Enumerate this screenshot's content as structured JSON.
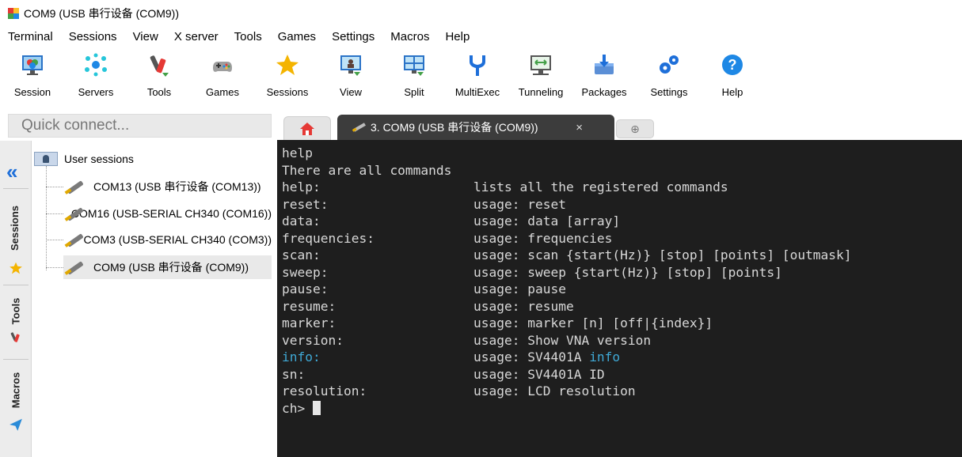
{
  "window": {
    "title": "COM9  (USB 串行设备 (COM9))"
  },
  "menubar": [
    "Terminal",
    "Sessions",
    "View",
    "X server",
    "Tools",
    "Games",
    "Settings",
    "Macros",
    "Help"
  ],
  "toolbar": [
    {
      "label": "Session",
      "icon": "monitor-session-icon"
    },
    {
      "label": "Servers",
      "icon": "servers-network-icon"
    },
    {
      "label": "Tools",
      "icon": "tools-icon"
    },
    {
      "label": "Games",
      "icon": "gamepad-icon"
    },
    {
      "label": "Sessions",
      "icon": "star-icon"
    },
    {
      "label": "View",
      "icon": "view-monitor-icon"
    },
    {
      "label": "Split",
      "icon": "split-window-icon"
    },
    {
      "label": "MultiExec",
      "icon": "multiexec-fork-icon"
    },
    {
      "label": "Tunneling",
      "icon": "tunneling-icon"
    },
    {
      "label": "Packages",
      "icon": "packages-download-icon"
    },
    {
      "label": "Settings",
      "icon": "gears-icon"
    },
    {
      "label": "Help",
      "icon": "help-question-icon"
    }
  ],
  "quick_connect": {
    "placeholder": "Quick connect..."
  },
  "tabs": {
    "active": {
      "label": "3. COM9  (USB 串行设备 (COM9))",
      "close": "×"
    },
    "new_tab": "⊕"
  },
  "side_rail": {
    "collapse": "«",
    "sessions": "Sessions",
    "tools": "Tools",
    "macros": "Macros"
  },
  "session_tree": {
    "root": "User sessions",
    "items": [
      {
        "label": "COM13  (USB 串行设备 (COM13))"
      },
      {
        "label": "COM16  (USB-SERIAL CH340 (COM16))"
      },
      {
        "label": "COM3  (USB-SERIAL CH340 (COM3))"
      },
      {
        "label": "COM9  (USB 串行设备 (COM9))"
      }
    ]
  },
  "terminal": {
    "lines": [
      {
        "cmd": "help",
        "desc": ""
      },
      {
        "cmd": "There are all commands",
        "desc": ""
      },
      {
        "cmd": "help:",
        "desc": "lists all the registered commands"
      },
      {
        "cmd": "reset:",
        "desc": "usage: reset"
      },
      {
        "cmd": "data:",
        "desc": "usage: data [array]"
      },
      {
        "cmd": "frequencies:",
        "desc": "usage: frequencies"
      },
      {
        "cmd": "scan:",
        "desc": "usage: scan {start(Hz)} [stop] [points] [outmask]"
      },
      {
        "cmd": "sweep:",
        "desc": "usage: sweep {start(Hz)} [stop] [points]"
      },
      {
        "cmd": "pause:",
        "desc": "usage: pause"
      },
      {
        "cmd": "resume:",
        "desc": "usage: resume"
      },
      {
        "cmd": "marker:",
        "desc": "usage: marker [n] [off|{index}]"
      },
      {
        "cmd": "version:",
        "desc": "usage: Show VNA version"
      },
      {
        "cmd": "info:",
        "desc": "usage: SV4401A ",
        "highlight": "info"
      },
      {
        "cmd": "sn:",
        "desc": "usage: SV4401A ID"
      },
      {
        "cmd": "resolution:",
        "desc": "usage: LCD resolution"
      }
    ],
    "prompt": "ch> ",
    "highlight_color": "#3fa9d6"
  }
}
